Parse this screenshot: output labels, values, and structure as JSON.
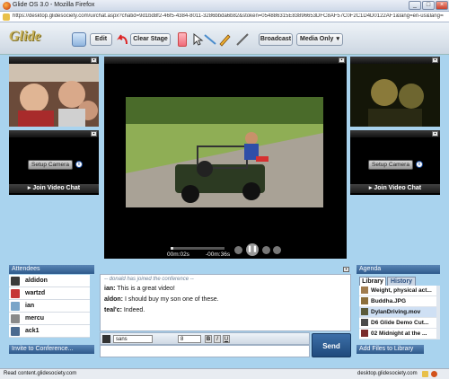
{
  "window": {
    "title": "Glide OS 3.0 - Mozilla Firefox",
    "url": "https://desktop.glidesociety.com/ui/chat.aspx?chatid=9d1bd8f2-46f5-4384-8011-3286bbda6b82&stoken=054886315E83896653DFC8AF57C0F2C1D4D0122AF1&lang=en-us&lang=en-us&cobu=1"
  },
  "app": {
    "logo": "Glide"
  },
  "toolbar": {
    "edit_label": "Edit",
    "clear_stage_label": "Clear Stage",
    "broadcast_label": "Broadcast",
    "media_select_value": "Media Only"
  },
  "stage": {
    "time_elapsed": "00m:02s",
    "time_remaining": "-00m:36s",
    "progress": 0.05
  },
  "video_panels": {
    "setup_camera_label": "Setup Camera",
    "join_video_chat_label": "Join Video Chat"
  },
  "attendees": {
    "title": "Attendees",
    "items": [
      {
        "name": "aldidon"
      },
      {
        "name": "wartzd"
      },
      {
        "name": "ian"
      },
      {
        "name": "mercu"
      },
      {
        "name": "ack1"
      }
    ],
    "invite_label": "Invite to Conference..."
  },
  "chat": {
    "system_message": "-- donald has joined the conference --",
    "messages": [
      {
        "sender": "ian:",
        "text": "This is a great video!"
      },
      {
        "sender": "aldon:",
        "text": "I should buy my son one of these."
      },
      {
        "sender": "teal'c:",
        "text": "Indeed."
      }
    ],
    "font_value": "sans",
    "size_value": "8",
    "send_label": "Send"
  },
  "agenda": {
    "title": "Agenda",
    "tab_library": "Library",
    "tab_history": "History",
    "items": [
      {
        "name": "Weight, physical act..."
      },
      {
        "name": "Buddha.JPG"
      },
      {
        "name": "DylanDriving.mov"
      },
      {
        "name": "D6 Glide Demo Cut..."
      },
      {
        "name": "02 Midnight at the ..."
      }
    ],
    "add_files_label": "Add Files to Library"
  },
  "status": {
    "left_text": "Read content.glidesociety.com",
    "right_text": "desktop.glidesociety.com"
  },
  "colors": {
    "app_background": "#a9d3ee",
    "section_title": "#3a6698",
    "video_background": "#000000"
  }
}
